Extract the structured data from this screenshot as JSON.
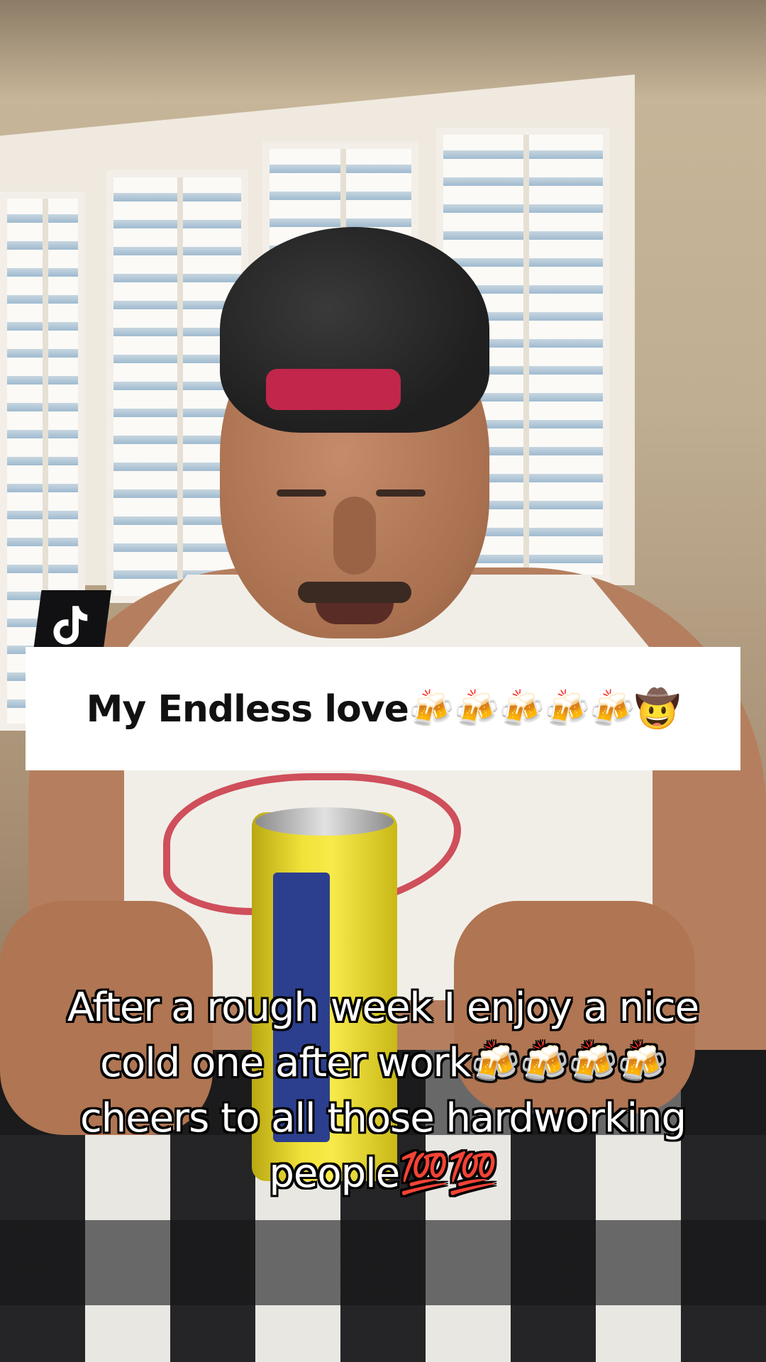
{
  "video": {
    "title_overlay": "My Endless love🍻🍻🍻🍻🍻🤠",
    "caption": "After a rough week I enjoy a nice cold one after work🍻🍻🍻🍻 cheers to all those hardworking people💯💯",
    "badge_icon": "tiktok-logo-icon"
  },
  "colors": {
    "title_card_bg": "#ffffff",
    "title_text": "#111111",
    "caption_text": "#ffffff",
    "caption_outline": "#000000",
    "badge_bg": "#111113"
  }
}
